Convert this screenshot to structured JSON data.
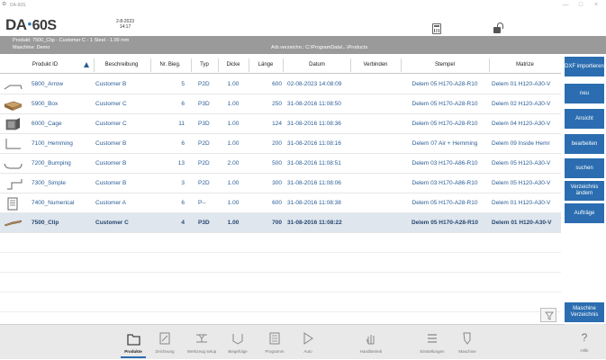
{
  "window": {
    "title": "DA-60S",
    "controls": [
      "—",
      "□",
      "×"
    ]
  },
  "header": {
    "logo_prefix": "DA",
    "logo_model": "60S",
    "date": "2-8-2023",
    "time": "14:17",
    "icons": [
      "calculator-icon",
      "unlock-icon"
    ]
  },
  "infobar": {
    "product_line": "Produkt: 7500_Clip - Customer C - 1 Steel - 1.00 mm",
    "machine_line": "Maschine: Demo",
    "directory": "Arb.verzeichn.: C:\\ProgramData\\...\\Products"
  },
  "table": {
    "headers": [
      "Produkt ID",
      "Beschreibung",
      "Nr. Bieg.",
      "Typ",
      "Dicke",
      "Länge",
      "Datum",
      "Verbinden",
      "Stempel",
      "Matrize"
    ],
    "rows": [
      {
        "id": "5800_Arrow",
        "desc": "Customer B",
        "bends": "5",
        "type": "P2D",
        "thick": "1.00",
        "len": "600",
        "date": "02-08-2023 14:08:09",
        "link": "",
        "punch": "Delem 05 H170-A28-R10",
        "die": "Delem 01 H120-A30-V",
        "thumb": "arrow"
      },
      {
        "id": "5900_Box",
        "desc": "Customer C",
        "bends": "6",
        "type": "P3D",
        "thick": "1.00",
        "len": "250",
        "date": "31-08-2016 11:08:50",
        "link": "",
        "punch": "Delem 05 H170-A28-R10",
        "die": "Delem 02 H120-A30-V",
        "thumb": "box"
      },
      {
        "id": "6000_Cage",
        "desc": "Customer C",
        "bends": "11",
        "type": "P3D",
        "thick": "1.00",
        "len": "124",
        "date": "31-08-2016 11:08:36",
        "link": "",
        "punch": "Delem 05 H170-A28-R10",
        "die": "Delem 04 H120-A30-V",
        "thumb": "cage"
      },
      {
        "id": "7100_Hemming",
        "desc": "Customer B",
        "bends": "6",
        "type": "P2D",
        "thick": "1.00",
        "len": "200",
        "date": "31-08-2016 11:08:16",
        "link": "",
        "punch": "Delem 07 Air + Hemming",
        "die": "Delem 09 Inside Hemr",
        "thumb": "hemming"
      },
      {
        "id": "7200_Bumping",
        "desc": "Customer B",
        "bends": "13",
        "type": "P2D",
        "thick": "2.00",
        "len": "500",
        "date": "31-08-2016 11:08:51",
        "link": "",
        "punch": "Delem 03 H170-A86-R10",
        "die": "Delem 05 H120-A30-V",
        "thumb": "bumping"
      },
      {
        "id": "7300_Simple",
        "desc": "Customer B",
        "bends": "3",
        "type": "P2D",
        "thick": "1.00",
        "len": "300",
        "date": "31-08-2016 11:08:06",
        "link": "",
        "punch": "Delem 03 H170-A86-R10",
        "die": "Delem 05 H120-A30-V",
        "thumb": "simple"
      },
      {
        "id": "7400_Numerical",
        "desc": "Customer A",
        "bends": "6",
        "type": "P--",
        "thick": "1.00",
        "len": "600",
        "date": "31-08-2016 11:08:38",
        "link": "",
        "punch": "Delem 05 H170-A28-R10",
        "die": "Delem 01 H120-A30-V",
        "thumb": "numerical"
      },
      {
        "id": "7500_Clip",
        "desc": "Customer C",
        "bends": "4",
        "type": "P3D",
        "thick": "1.00",
        "len": "700",
        "date": "31-08-2016 11:08:22",
        "link": "",
        "punch": "Delem 05 H170-A28-R10",
        "die": "Delem 01 H120-A30-V",
        "thumb": "clip",
        "selected": true
      }
    ]
  },
  "sidebar": {
    "buttons": [
      {
        "label": "DXF importieren",
        "name": "dxf-import-button"
      },
      {
        "label": "neu",
        "name": "new-button"
      },
      {
        "label": "Ansicht",
        "name": "view-button"
      },
      {
        "label": "bearbeiten",
        "name": "edit-button"
      },
      {
        "label": "suchen",
        "name": "search-button"
      },
      {
        "label": "Verzeichnis ändern",
        "name": "change-directory-button"
      },
      {
        "label": "Aufträge",
        "name": "orders-button"
      }
    ],
    "machine_dir_label": "Maschine Verzeichnis"
  },
  "bottombar": {
    "items": [
      {
        "label": "Produkte",
        "name": "nav-products",
        "icon": "folder-icon",
        "active": true
      },
      {
        "label": "Zeichnung",
        "name": "nav-drawing",
        "icon": "drawing-icon"
      },
      {
        "label": "Werkzeug setup",
        "name": "nav-tool-setup",
        "icon": "tool-setup-icon"
      },
      {
        "label": "Biegefolge",
        "name": "nav-bend-sequence",
        "icon": "bend-sequence-icon"
      },
      {
        "label": "Programm",
        "name": "nav-program",
        "icon": "program-icon"
      },
      {
        "label": "Auto",
        "name": "nav-auto",
        "icon": "play-icon"
      },
      {
        "label": "Handbetrieb",
        "name": "nav-manual",
        "icon": "hand-icon"
      },
      {
        "label": "Einstellungen",
        "name": "nav-settings",
        "icon": "settings-list-icon"
      },
      {
        "label": "Maschine",
        "name": "nav-machine",
        "icon": "machine-icon"
      }
    ],
    "help_label": "Hilfe",
    "help_glyph": "?"
  },
  "colors": {
    "accent": "#2b6db0",
    "link_text": "#2a5d96",
    "infobar": "#9a9a9a",
    "selected_row": "#dfe6ee"
  }
}
